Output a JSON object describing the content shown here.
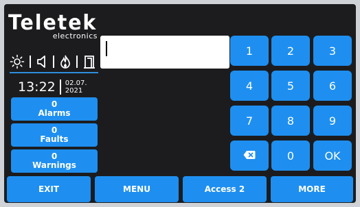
{
  "brand": {
    "name": "Teletek",
    "subtitle": "electronics"
  },
  "status": {
    "icons": [
      "light-sun-icon",
      "speaker-icon",
      "fire-icon",
      "door-icon"
    ]
  },
  "clock": {
    "time": "13:22",
    "date_day_month": "02.07.",
    "date_year": "2021"
  },
  "counters": [
    {
      "count": "0",
      "label": "Alarms"
    },
    {
      "count": "0",
      "label": "Faults"
    },
    {
      "count": "0",
      "label": "Warnings"
    }
  ],
  "display": {
    "value": ""
  },
  "keypad": {
    "k1": "1",
    "k2": "2",
    "k3": "3",
    "k4": "4",
    "k5": "5",
    "k6": "6",
    "k7": "7",
    "k8": "8",
    "k9": "9",
    "k0": "0",
    "ok": "OK"
  },
  "bottom": {
    "exit": "EXIT",
    "menu": "MENU",
    "access": "Access 2",
    "more": "MORE"
  },
  "colors": {
    "accent": "#1e8ff0",
    "background": "#1c1c1e"
  }
}
